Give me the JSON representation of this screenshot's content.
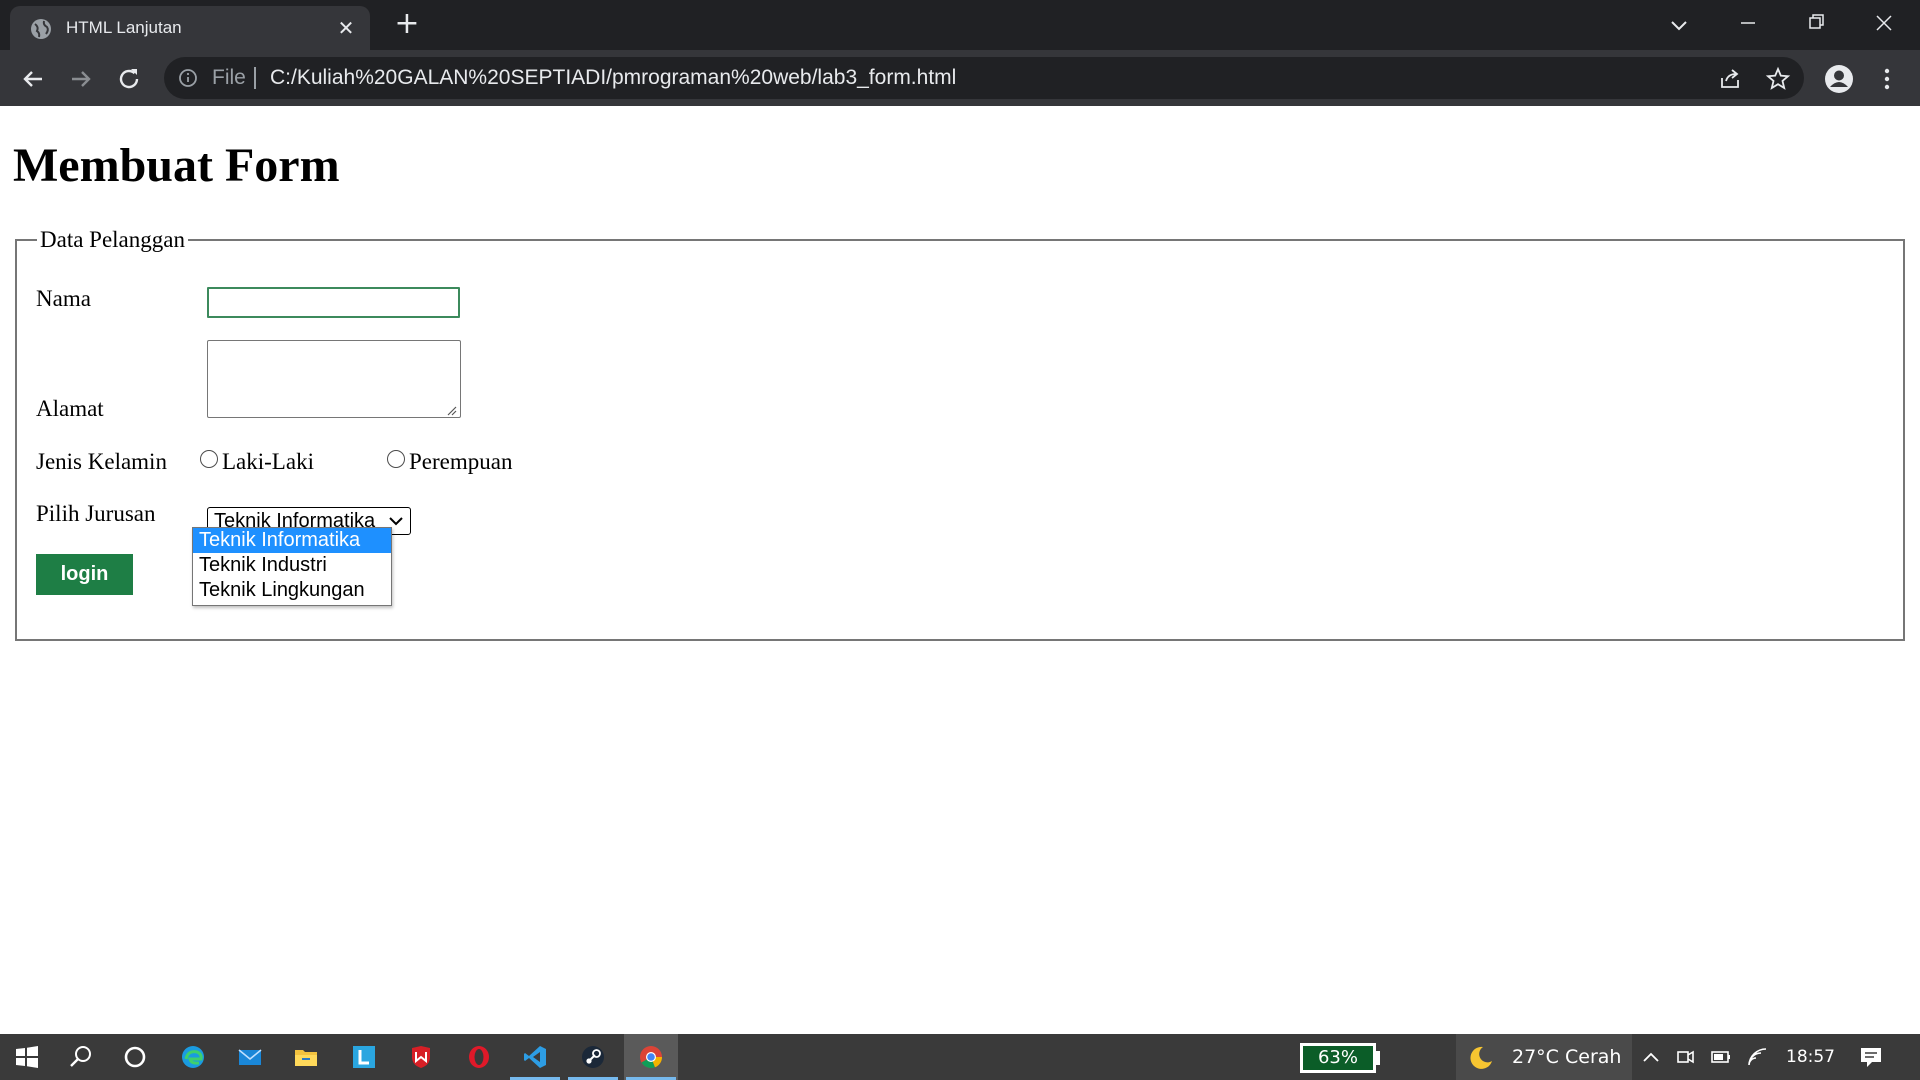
{
  "browser": {
    "tab_title": "HTML Lanjutan",
    "tab_close": "✕",
    "new_tab": "+",
    "scheme": "File",
    "url": "C:/Kuliah%20GALAN%20SEPTIADI/pmrograman%20web/lab3_form.html"
  },
  "page": {
    "title": "Membuat Form",
    "fieldset_legend": "Data Pelanggan",
    "labels": {
      "nama": "Nama",
      "alamat": "Alamat",
      "jenis_kelamin": "Jenis Kelamin",
      "pilih_jurusan": "Pilih Jurusan"
    },
    "nama_value": "",
    "alamat_value": "",
    "gender_options": [
      "Laki-Laki",
      "Perempuan"
    ],
    "jurusan_selected": "Teknik Informatika",
    "jurusan_options": [
      "Teknik Informatika",
      "Teknik Industri",
      "Teknik Lingkungan"
    ],
    "login_label": "login"
  },
  "taskbar": {
    "battery": "63%",
    "weather": "27°C  Cerah",
    "clock": "18:57"
  },
  "colors": {
    "chrome_dark": "#202124",
    "chrome_toolbar": "#35363a",
    "button_green": "#1e7e45",
    "dropdown_highlight": "#1e90ff",
    "taskbar": "#3a3a3a"
  }
}
